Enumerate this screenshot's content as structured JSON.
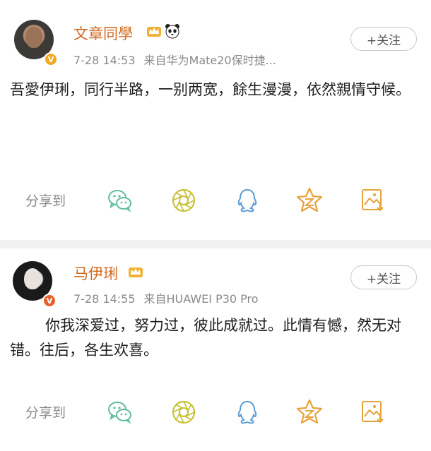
{
  "posts": [
    {
      "username": "文章同學",
      "time": "7-28 14:53",
      "source": "来自华为Mate20保时捷...",
      "follow_label": "+关注",
      "content": "吾愛伊琍，同行半路，一别两宽，餘生漫漫，依然親情守候。",
      "share_label": "分享到",
      "icons": [
        "avatar",
        "verified-badge",
        "crown-icon",
        "panda-icon"
      ]
    },
    {
      "username": "马伊琍",
      "time": "7-28 14:55",
      "source": "来自HUAWEI P30 Pro",
      "follow_label": "+关注",
      "content": "你我深爱过，努力过，彼此成就过。此情有憾，然无对错。往后，各生欢喜。",
      "share_label": "分享到",
      "icons": [
        "avatar",
        "verified-badge",
        "crown-icon"
      ]
    }
  ],
  "share_targets": [
    "wechat-icon",
    "moments-icon",
    "qq-icon",
    "qzone-icon",
    "save-image-icon"
  ],
  "colors": {
    "username": "#d2691e",
    "meta_text": "#8a8a8a",
    "icon_green": "#5fbf9a",
    "icon_yellow": "#c8c23a",
    "icon_blue": "#5b9bd5",
    "icon_orange": "#e8a23a",
    "verified_gold": "#f5a623",
    "verified_orange": "#e8612c"
  }
}
